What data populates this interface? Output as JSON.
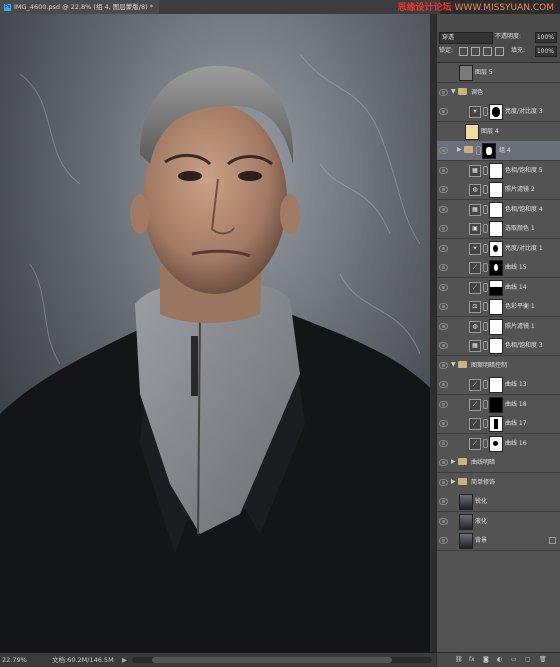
{
  "title": {
    "tab": "IMG_4600.psd @ 22.8% (组 4, 图层蒙版/8) *",
    "app_badge": "Ps"
  },
  "watermark": {
    "line1": "思缘设计论坛",
    "line2": "WWW.MISSYUAN.COM"
  },
  "status": {
    "zoom": "22.79%",
    "doc": "文档:60.2M/146.5M",
    "arrow": "▶"
  },
  "layers_panel": {
    "blend_mode": "穿透",
    "opacity_label": "不透明度:",
    "opacity_value": "100%",
    "lock_label": "锁定:",
    "fill_label": "填充:",
    "fill_value": "100%",
    "layers": [
      {
        "name": "图层 5",
        "type": "pixel",
        "thumb": "#7a7a7a",
        "eye": false
      },
      {
        "name": "调色",
        "type": "group",
        "open": true,
        "eye": true
      },
      {
        "name": "亮度/对比度 3",
        "type": "adj",
        "icon": "☀",
        "mask": "dark-blob",
        "eye": true
      },
      {
        "name": "图层 4",
        "type": "pixel",
        "thumb": "#f2dfa0",
        "eye": false
      },
      {
        "name": "组 4",
        "type": "group",
        "open": false,
        "mask": "dark-blob",
        "eye": true,
        "selected": true
      },
      {
        "name": "色相/饱和度 5",
        "type": "adj",
        "icon": "▦",
        "mask": "white",
        "eye": true
      },
      {
        "name": "照片滤镜 2",
        "type": "adj",
        "icon": "◍",
        "mask": "white",
        "eye": true
      },
      {
        "name": "色相/饱和度 4",
        "type": "adj",
        "icon": "▦",
        "mask": "white",
        "eye": true
      },
      {
        "name": "选取颜色 1",
        "type": "adj",
        "icon": "▣",
        "mask": "white",
        "eye": true
      },
      {
        "name": "亮度/对比度 1",
        "type": "adj",
        "icon": "☀",
        "mask": "black-spot",
        "eye": true
      },
      {
        "name": "曲线 15",
        "type": "adj",
        "icon": "⟋",
        "mask": "white-spot",
        "eye": true
      },
      {
        "name": "曲线 14",
        "type": "adj",
        "icon": "⟋",
        "mask": "white-top",
        "eye": true
      },
      {
        "name": "色彩平衡 1",
        "type": "adj",
        "icon": "⚖",
        "mask": "white",
        "eye": true
      },
      {
        "name": "照片滤镜 1",
        "type": "adj",
        "icon": "◍",
        "mask": "white",
        "eye": true
      },
      {
        "name": "色相/饱和度 3",
        "type": "adj",
        "icon": "▦",
        "mask": "white",
        "eye": true
      },
      {
        "name": "图案明暗控制",
        "type": "group",
        "open": true,
        "eye": true
      },
      {
        "name": "曲线 13",
        "type": "adj",
        "icon": "⟋",
        "mask": "white",
        "eye": true
      },
      {
        "name": "曲线 18",
        "type": "adj",
        "icon": "⟋",
        "mask": "black",
        "eye": true
      },
      {
        "name": "曲线 17",
        "type": "adj",
        "icon": "⟋",
        "mask": "white-v",
        "eye": true
      },
      {
        "name": "曲线 16",
        "type": "adj",
        "icon": "⟋",
        "mask": "white-blob",
        "eye": true
      },
      {
        "name": "曲线明暗",
        "type": "group",
        "open": false,
        "eye": true
      },
      {
        "name": "简单修饰",
        "type": "group",
        "open": false,
        "eye": true
      },
      {
        "name": "锐化",
        "type": "pixel",
        "thumb": "portrait",
        "eye": true
      },
      {
        "name": "液化",
        "type": "pixel",
        "thumb": "portrait",
        "eye": true
      },
      {
        "name": "背景",
        "type": "pixel",
        "thumb": "portrait",
        "eye": true,
        "locked": true
      }
    ]
  },
  "bottom_icons": {
    "link": "⛓",
    "fx": "fx",
    "mask": "◙",
    "adj": "◐",
    "folder": "▭",
    "new": "▢",
    "trash": "🗑"
  }
}
